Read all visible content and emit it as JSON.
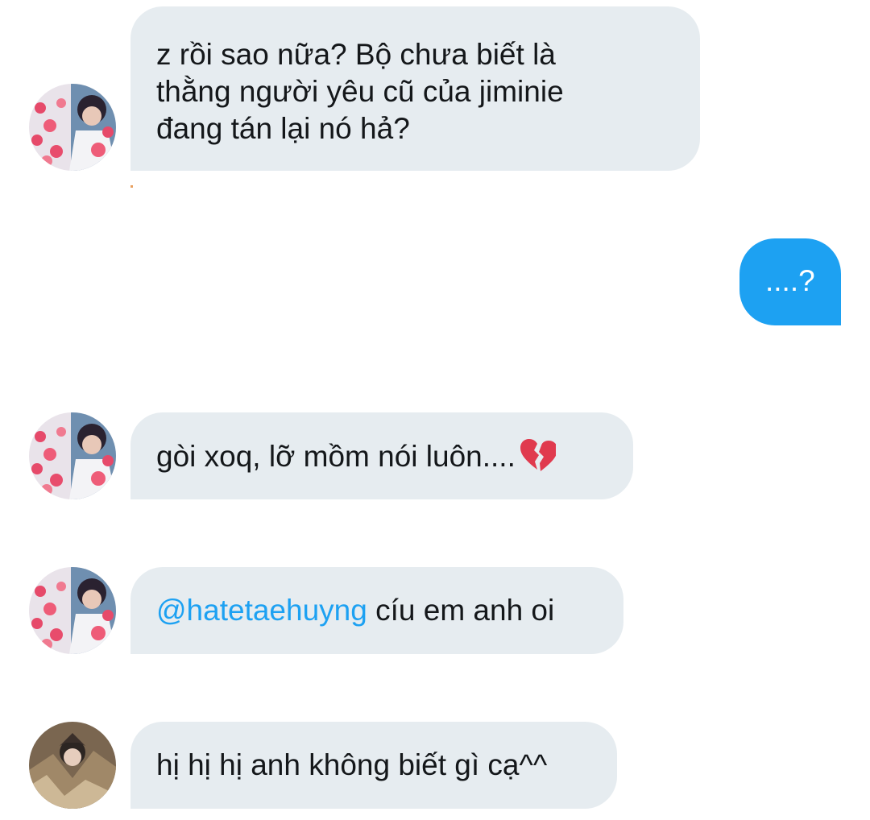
{
  "conversation": {
    "messages": [
      {
        "direction": "received",
        "sender": "user-a",
        "lines": [
          "z rồi sao nữa? Bộ chưa biết là",
          "thằng người yêu cũ của jiminie",
          "đang tán lại nó hả?"
        ]
      },
      {
        "direction": "sent",
        "text": "....?"
      },
      {
        "direction": "received",
        "sender": "user-a",
        "text": "gòi xoq, lỡ mồm nói luôn....",
        "emoji": "broken-heart"
      },
      {
        "direction": "received",
        "sender": "user-a",
        "mention": "@hatetaehuyng",
        "text": " cíu em anh oi"
      },
      {
        "direction": "received",
        "sender": "user-b",
        "text": "hị hị hị anh không biết gì cạ^^"
      }
    ]
  },
  "colors": {
    "received_bubble": "#e6ecf0",
    "sent_bubble": "#1da1f2",
    "mention": "#1da1f2",
    "text": "#14171a"
  },
  "icons": {
    "broken_heart": "broken-heart-icon",
    "avatar_a": "avatar-user-a",
    "avatar_b": "avatar-user-b"
  }
}
